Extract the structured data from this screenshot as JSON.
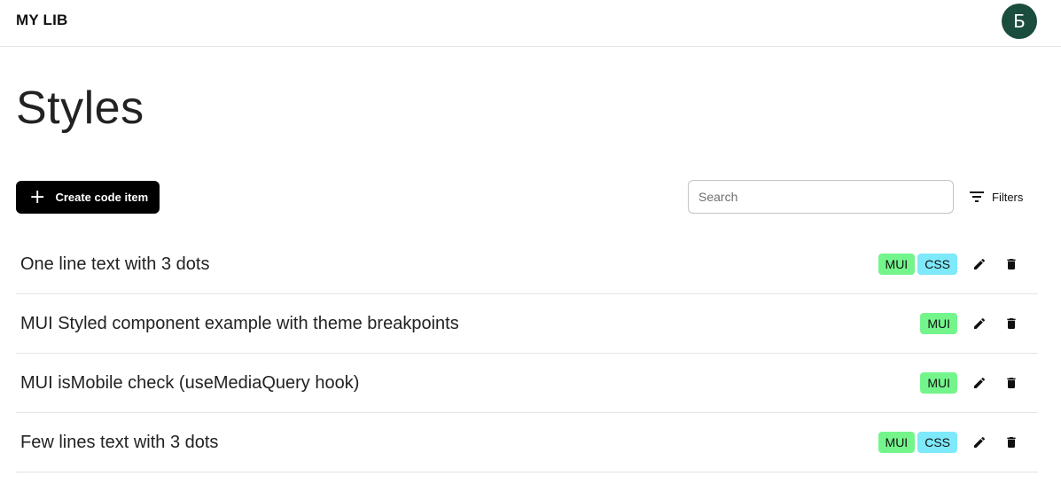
{
  "header": {
    "brand": "MY LIB",
    "avatar_initial": "Б",
    "avatar_color": "#1b4d3e"
  },
  "page": {
    "title": "Styles"
  },
  "toolbar": {
    "create_label": "Create code item",
    "search_placeholder": "Search",
    "search_value": "",
    "filters_label": "Filters"
  },
  "tag_colors": {
    "MUI": "#74f58c",
    "CSS": "#7ee9fa"
  },
  "items": [
    {
      "title": "One line text with 3 dots",
      "tags": [
        "MUI",
        "CSS"
      ]
    },
    {
      "title": "MUI Styled component example with theme breakpoints",
      "tags": [
        "MUI"
      ]
    },
    {
      "title": "MUI isMobile check (useMediaQuery hook)",
      "tags": [
        "MUI"
      ]
    },
    {
      "title": "Few lines text with 3 dots",
      "tags": [
        "MUI",
        "CSS"
      ]
    }
  ],
  "icons": {
    "create": "plus-icon",
    "filters": "filter-lines-icon",
    "edit": "pencil-icon",
    "delete": "trash-icon"
  }
}
